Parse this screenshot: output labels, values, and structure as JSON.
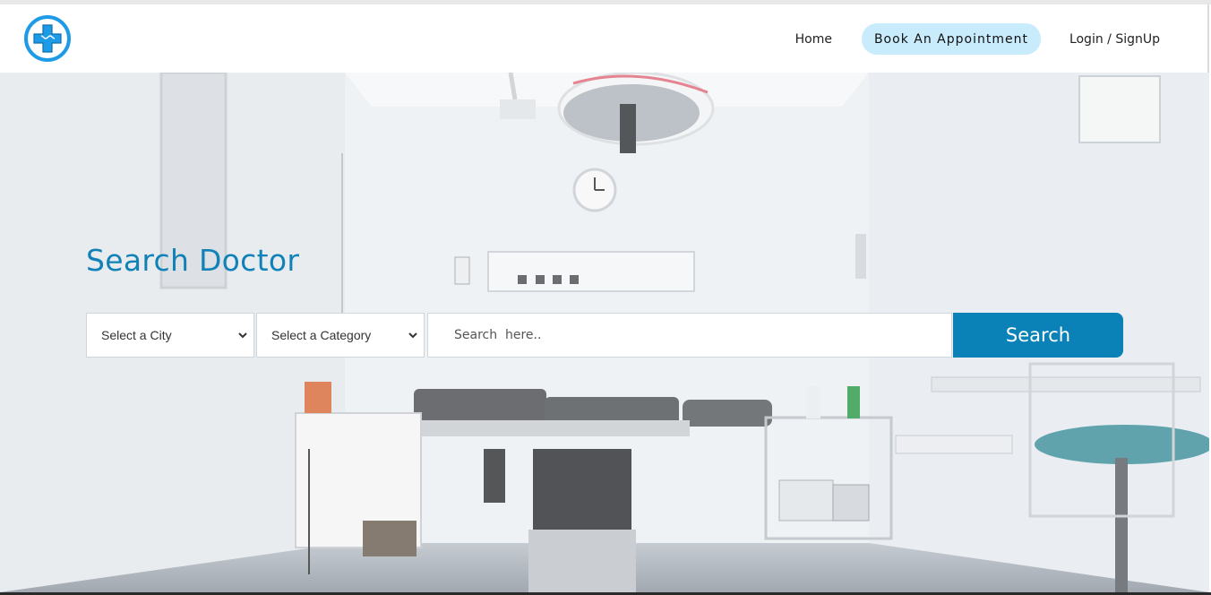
{
  "header": {
    "logo_icon": "medical-cross-logo-icon",
    "nav": {
      "home_label": "Home",
      "book_label": "Book An Appointment",
      "login_label": "Login / SignUp"
    }
  },
  "hero": {
    "background": "operating-room-photo",
    "title": "Search Doctor",
    "city_select": {
      "selected": "Select a City"
    },
    "category_select": {
      "selected": "Select a Category"
    },
    "search_input": {
      "value": "",
      "placeholder": "Search  here.."
    },
    "search_button_label": "Search"
  },
  "colors": {
    "brand_blue": "#0a82b8",
    "logo_blue": "#1e9be6",
    "book_pill": "#c9ecfc"
  }
}
